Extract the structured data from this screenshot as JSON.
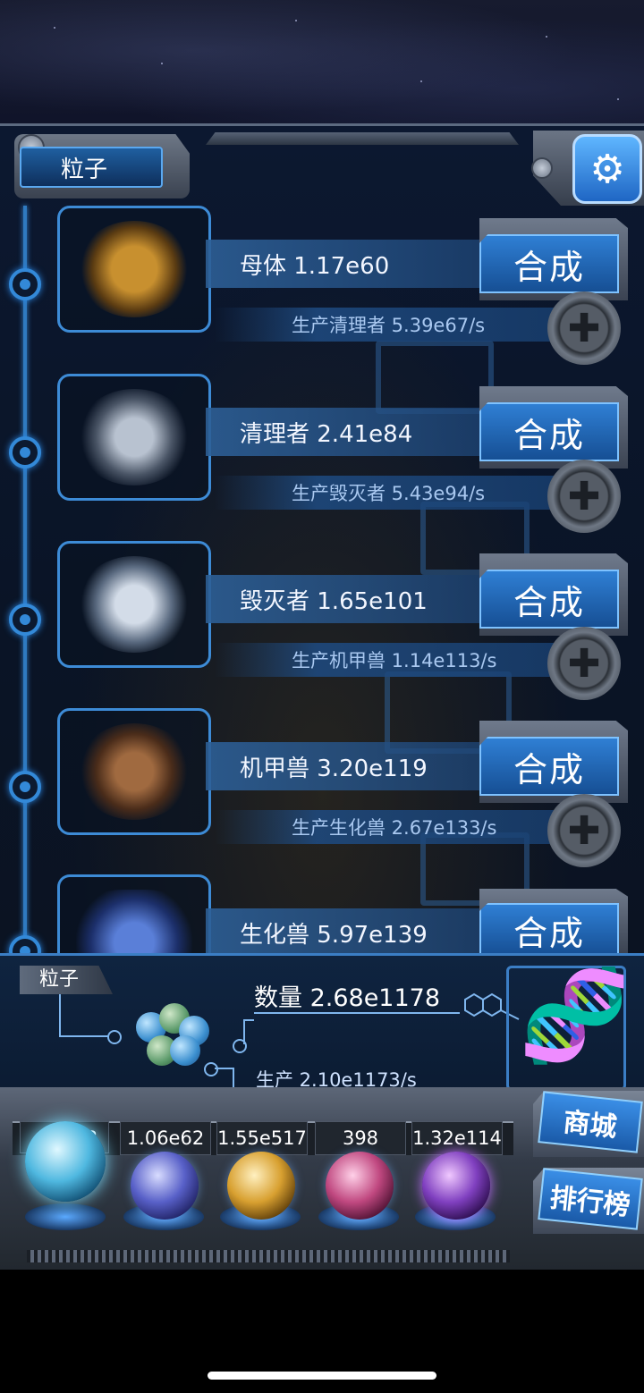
{
  "header": {
    "title": "粒子",
    "settings_icon": "gear-icon"
  },
  "units": [
    {
      "name_value": "母体 1.17e60",
      "production": "生产清理者 5.39e67/s",
      "synth_label": "合成",
      "art_color": "#b8892e"
    },
    {
      "name_value": "清理者 2.41e84",
      "production": "生产毁灭者 5.43e94/s",
      "synth_label": "合成",
      "art_color": "#8f9aa8"
    },
    {
      "name_value": "毁灭者 1.65e101",
      "production": "生产机甲兽 1.14e113/s",
      "synth_label": "合成",
      "art_color": "#9fb0c4"
    },
    {
      "name_value": "机甲兽 3.20e119",
      "production": "生产生化兽 2.67e133/s",
      "synth_label": "合成",
      "art_color": "#8a5a3c"
    },
    {
      "name_value": "生化兽 5.97e139",
      "production": "",
      "synth_label": "合成",
      "art_color": "#3c5fb8"
    }
  ],
  "info_panel": {
    "tab_label": "粒子",
    "quantity": "数量 2.68e1178",
    "production": "生产 2.10e1173/s"
  },
  "resources": [
    {
      "value": "2.68e1178",
      "visible_text": "78",
      "color": "#4fb8e0"
    },
    {
      "value": "1.06e62",
      "color": "#5860c8"
    },
    {
      "value": "1.55e517",
      "color": "#d8a030"
    },
    {
      "value": "398",
      "color": "#c04880"
    },
    {
      "value": "1.32e114",
      "color": "#8040c0"
    }
  ],
  "side_buttons": {
    "shop": "商城",
    "ranking": "排行榜"
  }
}
